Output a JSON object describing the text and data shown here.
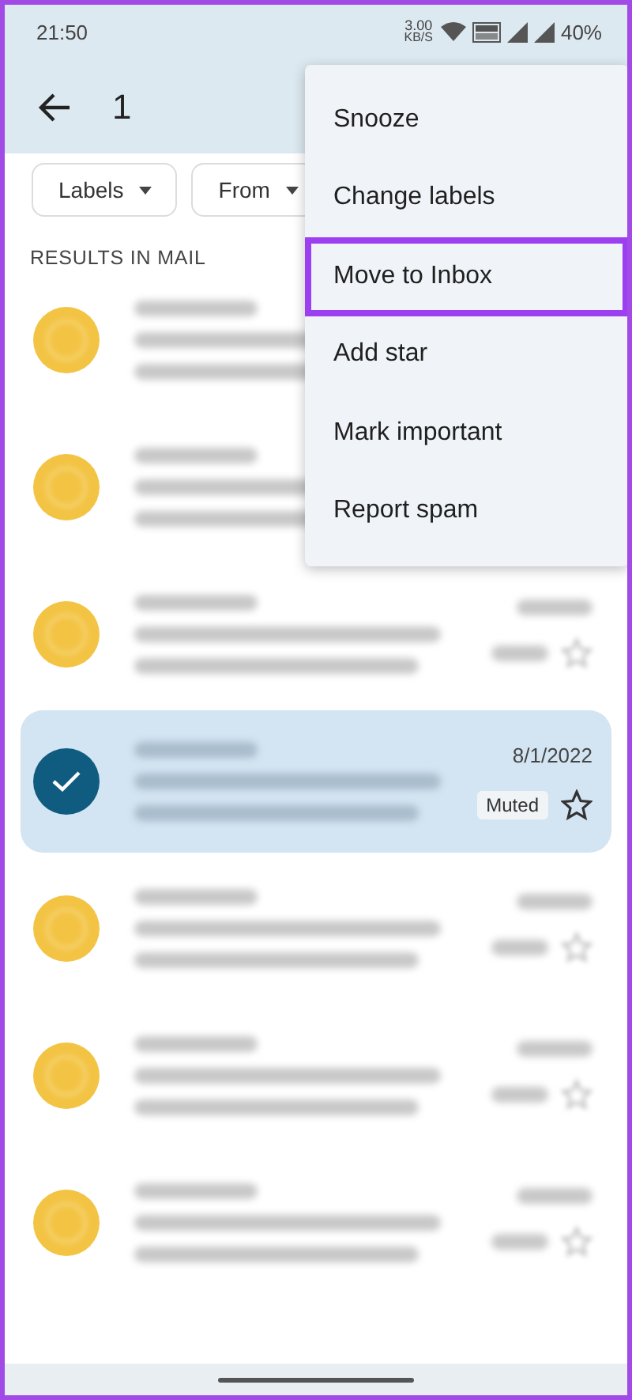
{
  "status_bar": {
    "time": "21:50",
    "speed": "3.00",
    "speed_unit": "KB/S",
    "battery": "40%"
  },
  "toolbar": {
    "count": "1"
  },
  "chips": [
    {
      "label": "Labels"
    },
    {
      "label": "From"
    }
  ],
  "section_title": "RESULTS IN MAIL",
  "emails": [
    {
      "selected": false
    },
    {
      "selected": false
    },
    {
      "selected": false,
      "shows_star": true
    },
    {
      "selected": true,
      "date": "8/1/2022",
      "badge": "Muted",
      "shows_star": true
    },
    {
      "selected": false,
      "shows_star": true
    },
    {
      "selected": false,
      "shows_star": true
    },
    {
      "selected": false,
      "shows_star": true
    }
  ],
  "menu": [
    {
      "label": "Snooze",
      "highlighted": false
    },
    {
      "label": "Change labels",
      "highlighted": false
    },
    {
      "label": "Move to Inbox",
      "highlighted": true
    },
    {
      "label": "Add star",
      "highlighted": false
    },
    {
      "label": "Mark important",
      "highlighted": false
    },
    {
      "label": "Report spam",
      "highlighted": false
    }
  ]
}
